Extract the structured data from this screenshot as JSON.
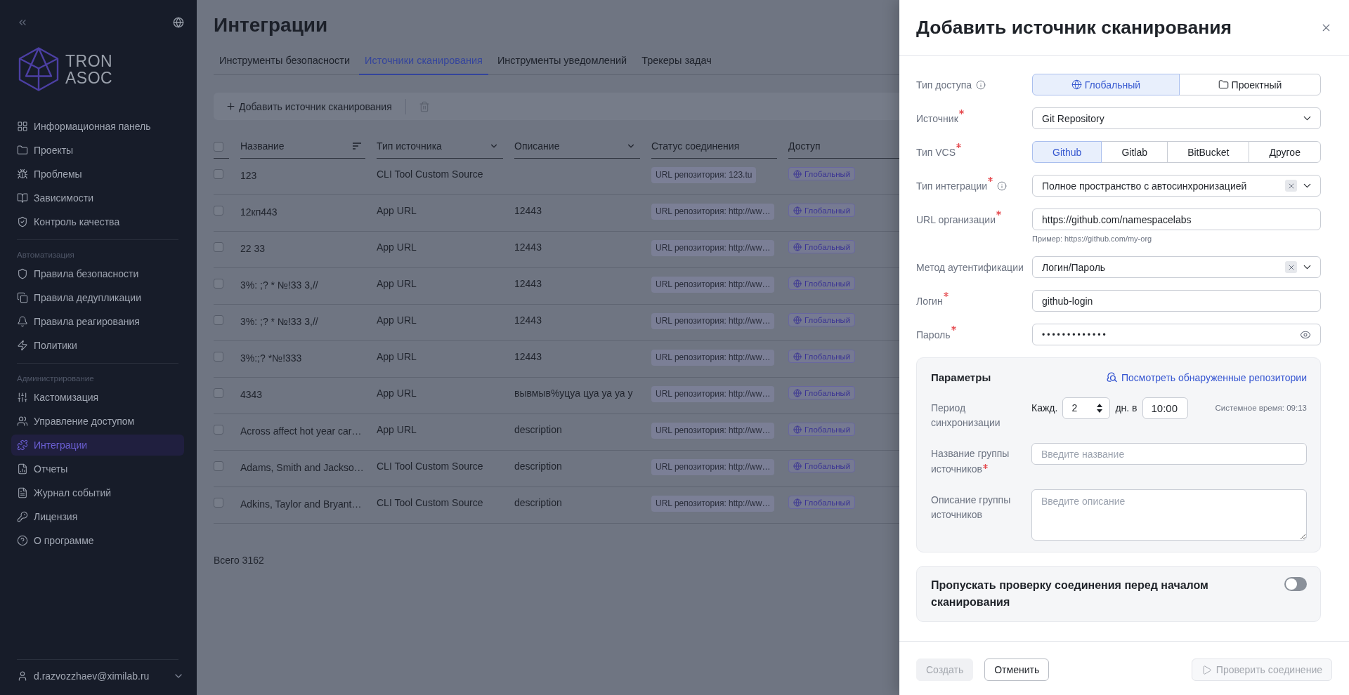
{
  "sidebar": {
    "logo": {
      "line_1": "TRON",
      "line_2": "ASOC"
    },
    "sections": [
      {
        "items": [
          {
            "label": "Информационная панель",
            "selected": false
          },
          {
            "label": "Проекты",
            "selected": false
          },
          {
            "label": "Проблемы",
            "selected": false
          },
          {
            "label": "Зависимости",
            "selected": false
          },
          {
            "label": "Контроль качества",
            "selected": false
          }
        ]
      },
      {
        "title": "Автоматизация",
        "items": [
          {
            "label": "Правила безопасности",
            "selected": false
          },
          {
            "label": "Правила дедупликации",
            "selected": false
          },
          {
            "label": "Правила реагирования",
            "selected": false
          },
          {
            "label": "Политики",
            "selected": false
          }
        ]
      },
      {
        "title": "Администрирование",
        "items": [
          {
            "label": "Кастомизация",
            "selected": false
          },
          {
            "label": "Управление доступом",
            "selected": false
          },
          {
            "label": "Интеграции",
            "selected": true
          },
          {
            "label": "Отчеты",
            "selected": false
          },
          {
            "label": "Журнал событий",
            "selected": false
          },
          {
            "label": "Лицензия",
            "selected": false
          },
          {
            "label": "О программе",
            "selected": false
          }
        ]
      }
    ],
    "user": "d.razvozzhaev@ximilab.ru"
  },
  "page": {
    "title": "Интеграции",
    "tabs": [
      {
        "label": "Инструменты безопасности",
        "selected": false
      },
      {
        "label": "Источники сканирования",
        "selected": true
      },
      {
        "label": "Инструменты уведомлений",
        "selected": false
      },
      {
        "label": "Трекеры задач",
        "selected": false
      }
    ],
    "toolbar": {
      "add_button": "Добавить источник сканирования",
      "delete_disabled": true
    },
    "table": {
      "all_checked": false,
      "columns": [
        {
          "label": "Название",
          "kind": "sort"
        },
        {
          "label": "Тип источника",
          "kind": "filter"
        },
        {
          "label": "Описание",
          "kind": "filter"
        },
        {
          "label": "Статус соединения",
          "kind": "plain"
        },
        {
          "label": "Доступ",
          "kind": "plain"
        }
      ],
      "rows": [
        {
          "checked": false,
          "name": "123",
          "source_type": "CLI Tool Custom Source",
          "status": "URL репозитория: 123.tu",
          "access": "Глобальный"
        },
        {
          "checked": false,
          "name": "12кп443",
          "source_type": "App URL",
          "description": "12443",
          "status": "URL репозитория: http://ww…",
          "access": "Глобальный"
        },
        {
          "checked": false,
          "name": "22 33",
          "source_type": "App URL",
          "description": "12443",
          "status": "URL репозитория: http://ww…",
          "access": "Глобальный"
        },
        {
          "checked": false,
          "name": "3%: ;? * №!33 3,//",
          "source_type": "App URL",
          "description": "12443",
          "status": "URL репозитория: http://ww…",
          "access": "Глобальный"
        },
        {
          "checked": false,
          "name": "3%: ;? * №!33 3,//",
          "source_type": "App URL",
          "description": "12443",
          "status": "URL репозитория: http://ww…",
          "access": "Глобальный"
        },
        {
          "checked": false,
          "name": "3%:;? *№!333",
          "source_type": "App URL",
          "description": "12443",
          "status": "URL репозитория: http://ww…",
          "access": "Глобальный"
        },
        {
          "checked": false,
          "name": "4343",
          "source_type": "App URL",
          "description": "вывмыв%уцуа цуа уа уа у",
          "status": "URL репозитория: http://ww…",
          "access": "Глобальный"
        },
        {
          "checked": false,
          "name": "Across affect hot year car…",
          "source_type": "App URL",
          "description": "description",
          "status": "URL репозитория: http://ww…",
          "access": "Глобальный"
        },
        {
          "checked": false,
          "name": "Adams, Smith and Jackso…",
          "source_type": "CLI Tool Custom Source",
          "description": "description",
          "status": "URL репозитория: http://ww…",
          "access": "Глобальный"
        },
        {
          "checked": false,
          "name": "Adkins, Taylor and Bryant…",
          "source_type": "CLI Tool Custom Source",
          "description": "description",
          "status": "URL репозитория: http://ww…",
          "access": "Глобальный"
        }
      ]
    },
    "total": "Всего 3162"
  },
  "drawer": {
    "title": "Добавить источник сканирования",
    "fields": [
      {
        "kind": "segmented",
        "label": "Тип доступа",
        "required": false,
        "info": true,
        "options": [
          {
            "label": "Глобальный",
            "selected": true
          },
          {
            "label": "Проектный",
            "selected": false
          }
        ]
      },
      {
        "kind": "select",
        "label": "Источник",
        "required": true,
        "value": "Git Repository"
      },
      {
        "kind": "segmented",
        "label": "Тип VCS",
        "required": true,
        "options": [
          {
            "label": "Github",
            "selected": true
          },
          {
            "label": "Gitlab",
            "selected": false
          },
          {
            "label": "BitBucket",
            "selected": false
          },
          {
            "label": "Другое",
            "selected": false
          }
        ]
      },
      {
        "kind": "select",
        "label": "Тип интеграции",
        "required": true,
        "info": true,
        "value": "Полное пространство с автосинхронизацией",
        "clearable": true
      },
      {
        "kind": "text",
        "label": "URL организации",
        "required": true,
        "value": "https://github.com/namespacelabs",
        "hint": "Пример: https://github.com/my-org"
      },
      {
        "kind": "select",
        "label": "Метод аутентификации",
        "required": false,
        "value": "Логин/Пароль",
        "clearable": true
      },
      {
        "kind": "text",
        "label": "Логин",
        "required": true,
        "value": "github-login"
      },
      {
        "kind": "password",
        "label": "Пароль",
        "required": true,
        "value": "•••••••••••••"
      }
    ],
    "parameters": {
      "title": "Параметры",
      "link": "Посмотреть обнаруженные репозитории",
      "sync": {
        "label": "Период синхронизации",
        "prefix": "Кажд.",
        "interval": "2",
        "unit": "дн. в",
        "time": "10:00",
        "system_time": "Системное время: 09:13"
      },
      "group_name": {
        "label": "Название группы источников",
        "required": true,
        "placeholder": "Введите название"
      },
      "group_description": {
        "label": "Описание группы источников",
        "required": false,
        "placeholder": "Введите описание"
      }
    },
    "skip_check": {
      "label": "Пропускать проверку соединения перед началом сканирования",
      "on": false
    },
    "footer": [
      {
        "kind": "primary",
        "label": "Создать",
        "disabled": true
      },
      {
        "kind": "secondary",
        "label": "Отменить",
        "disabled": false
      },
      {
        "kind": "test",
        "label": "Проверить соединение",
        "disabled": true
      }
    ]
  }
}
